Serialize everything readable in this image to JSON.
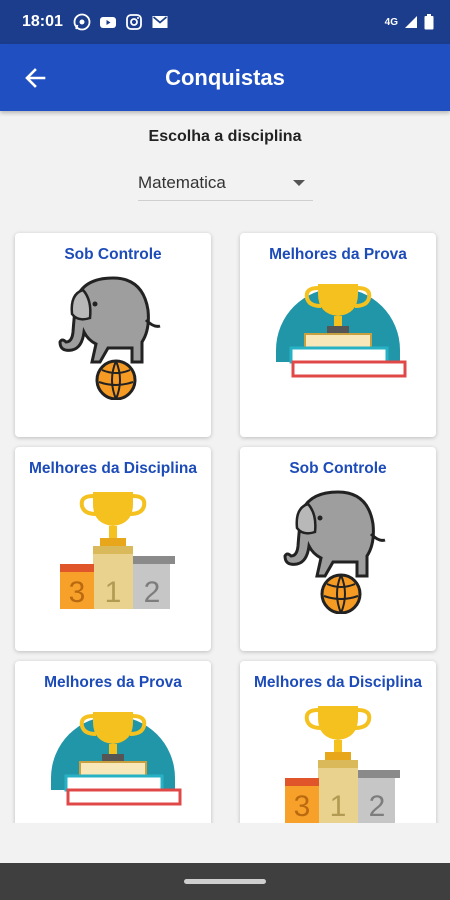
{
  "status_bar": {
    "time": "18:01",
    "network": "4G",
    "icons_left": [
      "whatsapp-icon",
      "youtube-icon",
      "instagram-icon",
      "gmail-icon"
    ],
    "icons_right": [
      "signal-icon",
      "battery-icon"
    ]
  },
  "app_bar": {
    "title": "Conquistas",
    "back_icon": "arrow-left-icon",
    "color": "#1f4fc1"
  },
  "picker": {
    "label": "Escolha a disciplina",
    "value": "Matematica"
  },
  "cards": [
    {
      "title": "Sob Controle",
      "image": "elephant-on-ball"
    },
    {
      "title": "Melhores da Prova",
      "image": "trophy-on-books"
    },
    {
      "title": "Melhores da Disciplina",
      "image": "trophy-podium"
    },
    {
      "title": "Sob Controle",
      "image": "elephant-on-ball"
    },
    {
      "title": "Melhores da Prova",
      "image": "trophy-on-books"
    },
    {
      "title": "Melhores da Disciplina",
      "image": "trophy-podium"
    }
  ],
  "podium_numbers": [
    "3",
    "1",
    "2"
  ],
  "colors": {
    "title_blue": "#1d4bb8",
    "status_bar": "#1c3d8c"
  }
}
